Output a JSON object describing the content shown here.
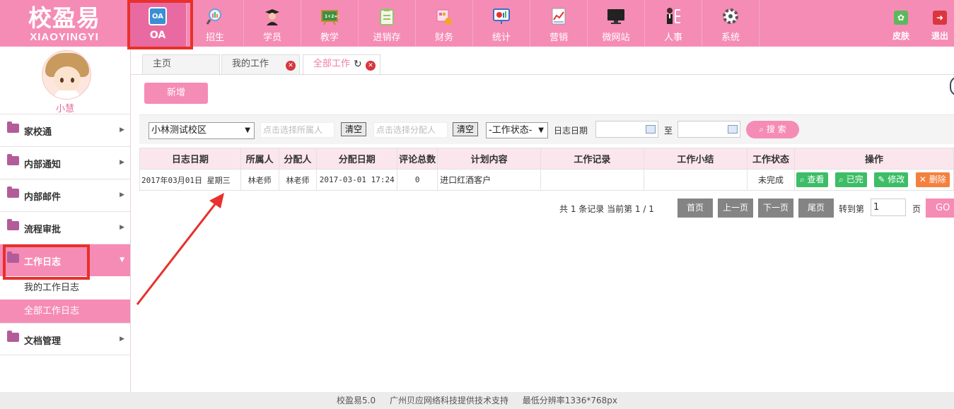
{
  "brand": {
    "title_cn": "校盈易",
    "title_en": "XIAOYINGYI"
  },
  "nav": [
    {
      "label": "OA",
      "icon": "oa-icon",
      "icon_text": "OA",
      "color": "#3a8fd6",
      "active": true
    },
    {
      "label": "招生",
      "icon": "magnifier-chart-icon",
      "color": "#6aa0d8"
    },
    {
      "label": "学员",
      "icon": "graduate-icon",
      "color": "#2b2b2b"
    },
    {
      "label": "教学",
      "icon": "blackboard-icon",
      "color": "#3d8f3d"
    },
    {
      "label": "进销存",
      "icon": "clipboard-icon",
      "color": "#9ac06a"
    },
    {
      "label": "财务",
      "icon": "finance-icon",
      "color": "#e9a33d"
    },
    {
      "label": "统计",
      "icon": "statistics-icon",
      "color": "#3b6ec8"
    },
    {
      "label": "营销",
      "icon": "marketing-chart-icon",
      "color": "#f2f2f2"
    },
    {
      "label": "微网站",
      "icon": "monitor-icon",
      "color": "#222222"
    },
    {
      "label": "人事",
      "icon": "person-org-icon",
      "color": "#4a2a2a"
    },
    {
      "label": "系统",
      "icon": "gear-icon",
      "color": "#555555"
    }
  ],
  "tools": {
    "skin": {
      "label": "皮肤",
      "icon": "skin-icon",
      "color": "#5cb85c"
    },
    "logout": {
      "label": "退出",
      "icon": "logout-icon",
      "color": "#d9363e"
    }
  },
  "user": {
    "name": "小慧"
  },
  "sidebar": {
    "items": [
      {
        "label": "家校通"
      },
      {
        "label": "内部通知"
      },
      {
        "label": "内部邮件"
      },
      {
        "label": "流程审批"
      },
      {
        "label": "工作日志",
        "active": true
      },
      {
        "label": "文档管理"
      }
    ],
    "sub": [
      {
        "label": "我的工作日志"
      },
      {
        "label": "全部工作日志",
        "active": true
      }
    ]
  },
  "tabs": [
    {
      "label": "主页"
    },
    {
      "label": "我的工作"
    },
    {
      "label": "全部工作",
      "active": true
    }
  ],
  "add_button": "新增",
  "filters": {
    "campus": "小林测试校区",
    "owner_placeholder": "点击选择所属人",
    "clear1": "清空",
    "assignee_placeholder": "点击选择分配人",
    "clear2": "清空",
    "status": "-工作状态-",
    "date_label": "日志日期",
    "to_label": "至",
    "search": "搜 索"
  },
  "table": {
    "headers": [
      "日志日期",
      "所属人",
      "分配人",
      "分配日期",
      "评论总数",
      "计划内容",
      "工作记录",
      "工作小结",
      "工作状态",
      "操作"
    ],
    "rows": [
      {
        "date": "2017年03月01日  星期三",
        "owner": "林老师",
        "assignee": "林老师",
        "assigned": "2017-03-01 17:24",
        "comments": "0",
        "plan": "进口红酒客户",
        "record": "",
        "summary": "",
        "status": "未完成",
        "ops": [
          "查看",
          "已完",
          "修改",
          "删除"
        ]
      }
    ]
  },
  "pager": {
    "info": "共 1 条记录 当前第 1 / 1",
    "first": "首页",
    "prev": "上一页",
    "next": "下一页",
    "last": "尾页",
    "goto_label": "转到第",
    "page_value": "1",
    "page_unit": "页",
    "go": "GO"
  },
  "footer": {
    "version": "校盈易5.0",
    "support": "广州贝应网络科技提供技术支持",
    "resolution": "最低分辨率1336*768px"
  },
  "colors": {
    "accent": "#f58cb5",
    "annotation": "#e8302c",
    "ok": "#3dbd66",
    "danger": "#f5803e"
  }
}
